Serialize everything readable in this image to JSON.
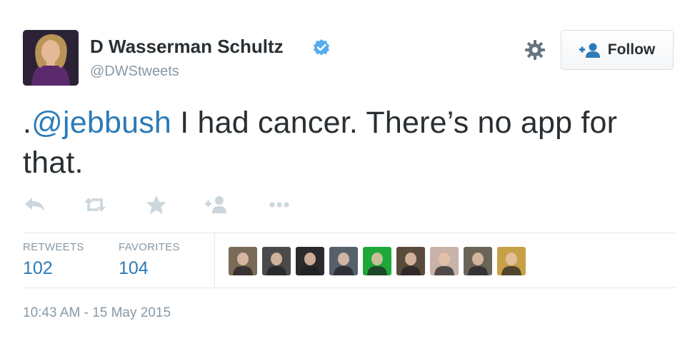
{
  "user": {
    "name": "D Wasserman Schultz",
    "handle": "@DWStweets",
    "verified": true
  },
  "header": {
    "follow_label": "Follow"
  },
  "tweet": {
    "prefix": ".",
    "mention": "@jebbush",
    "text": " I had cancer. There’s no app for that."
  },
  "actions": [
    "reply-icon",
    "retweet-icon",
    "favorite-icon",
    "follow-user-icon",
    "more-icon"
  ],
  "stats": {
    "retweets_label": "RETWEETS",
    "retweets_value": "102",
    "favorites_label": "FAVORITES",
    "favorites_value": "104"
  },
  "favoriters": [
    {
      "bg": "#7a6a58"
    },
    {
      "bg": "#4a4a4a"
    },
    {
      "bg": "#2b2a2c"
    },
    {
      "bg": "#56606a"
    },
    {
      "bg": "#1fa83a"
    },
    {
      "bg": "#5a4a3c"
    },
    {
      "bg": "#c9b3a8"
    },
    {
      "bg": "#6b6558"
    },
    {
      "bg": "#c8a048"
    }
  ],
  "timestamp": "10:43 AM - 15 May 2015",
  "colors": {
    "link": "#2b7bb9",
    "muted": "#8899a6",
    "verified": "#55acee"
  }
}
